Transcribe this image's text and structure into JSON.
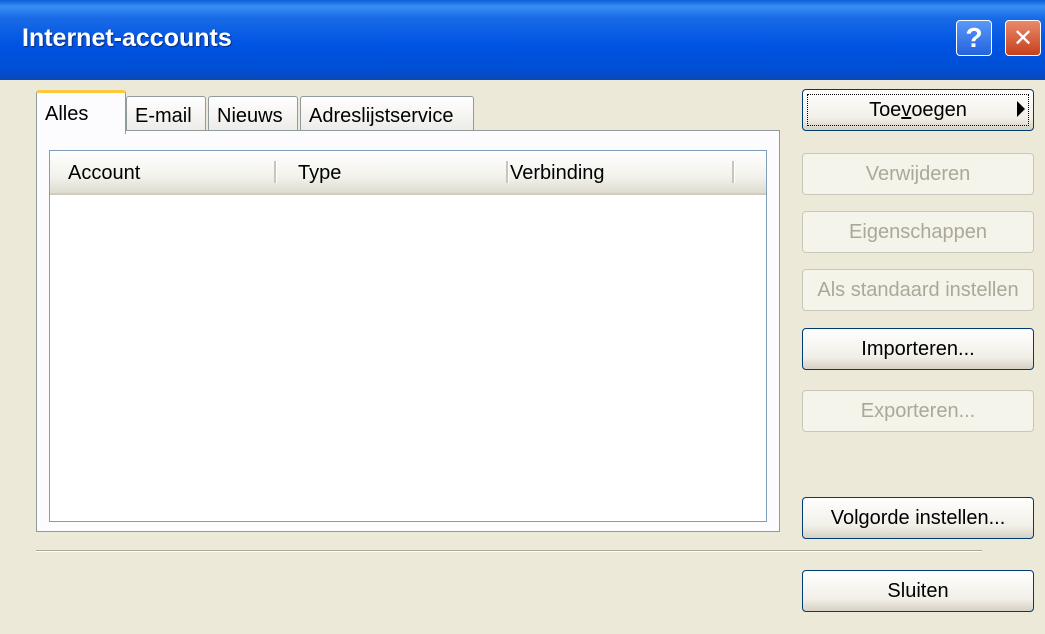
{
  "window": {
    "title": "Internet-accounts",
    "help_glyph": "?",
    "close_glyph": "✕"
  },
  "tabs": [
    {
      "label": "Alles",
      "active": true
    },
    {
      "label": "E-mail",
      "active": false
    },
    {
      "label": "Nieuws",
      "active": false
    },
    {
      "label": "Adreslijstservice",
      "active": false
    }
  ],
  "list": {
    "columns": [
      "Account",
      "Type",
      "Verbinding"
    ],
    "rows": []
  },
  "buttons": {
    "add": {
      "pre": "Toe",
      "mnemonic": "v",
      "post": "oegen",
      "enabled": true
    },
    "remove": {
      "label": "Verwijderen",
      "enabled": false
    },
    "properties": {
      "label": "Eigenschappen",
      "enabled": false
    },
    "set_default": {
      "label": "Als standaard instellen",
      "enabled": false
    },
    "import": {
      "label": "Importeren...",
      "enabled": true
    },
    "export": {
      "label": "Exporteren...",
      "enabled": false
    },
    "order": {
      "label": "Volgorde instellen...",
      "enabled": true
    },
    "close": {
      "label": "Sluiten",
      "enabled": true
    }
  },
  "colors": {
    "titlebar": "#0054e3",
    "dialog_bg": "#ece9d8",
    "active_tab_accent": "#ffc83c"
  }
}
